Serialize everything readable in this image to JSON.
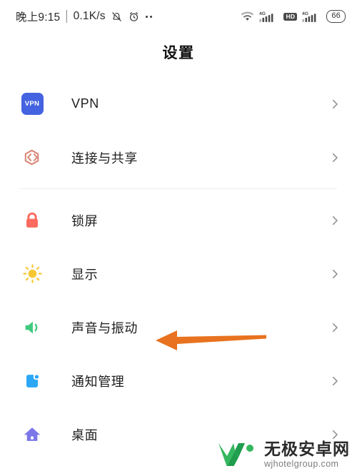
{
  "status_bar": {
    "time": "晚上9:15",
    "separator": "|",
    "network_speed": "0.1K/s",
    "alarm_muted_icon": "bell-slash-icon",
    "clock_icon": "alarm-clock-icon",
    "more_icon": "more-dots-icon",
    "wifi_icon": "wifi-icon",
    "sim1_label": "4G",
    "sim1_icon": "signal-bars-icon",
    "hd_label": "HD",
    "sim2_label": "4G",
    "sim2_icon": "signal-bars-icon",
    "battery_level": "66",
    "battery_icon": "battery-icon"
  },
  "header": {
    "title": "设置"
  },
  "colors": {
    "vpn": "#4463e0",
    "connection": "#d98575",
    "lock": "#fa6a5e",
    "display": "#f7c634",
    "sound": "#3fca7e",
    "notification": "#2ba7f5",
    "desktop": "#7b77e8",
    "annotation_arrow": "#e8721f",
    "chevron": "#8c8c8c",
    "divider": "#ededed"
  },
  "annotation": {
    "arrow_name": "orange-pointer-arrow",
    "points_to": "声音与振动"
  },
  "settings_groups": [
    {
      "group_name": "network-group",
      "items": [
        {
          "id": "vpn",
          "label": "VPN",
          "icon": "vpn-icon",
          "chevron": "chevron-right-icon"
        },
        {
          "id": "connection-sharing",
          "label": "连接与共享",
          "icon": "connection-share-icon",
          "chevron": "chevron-right-icon"
        }
      ]
    },
    {
      "group_name": "device-group",
      "items": [
        {
          "id": "lock-screen",
          "label": "锁屏",
          "icon": "lock-icon",
          "chevron": "chevron-right-icon"
        },
        {
          "id": "display",
          "label": "显示",
          "icon": "sun-brightness-icon",
          "chevron": "chevron-right-icon"
        },
        {
          "id": "sound-vibration",
          "label": "声音与振动",
          "icon": "speaker-volume-icon",
          "chevron": "chevron-right-icon"
        },
        {
          "id": "notification-management",
          "label": "通知管理",
          "icon": "notification-badge-icon",
          "chevron": "chevron-right-icon"
        },
        {
          "id": "desktop",
          "label": "桌面",
          "icon": "home-house-icon",
          "chevron": "chevron-right-icon"
        }
      ]
    }
  ],
  "watermark": {
    "logo_icon": "w-logo-icon",
    "site_name": "无极安卓网",
    "site_url": "wjhotelgroup.com"
  }
}
